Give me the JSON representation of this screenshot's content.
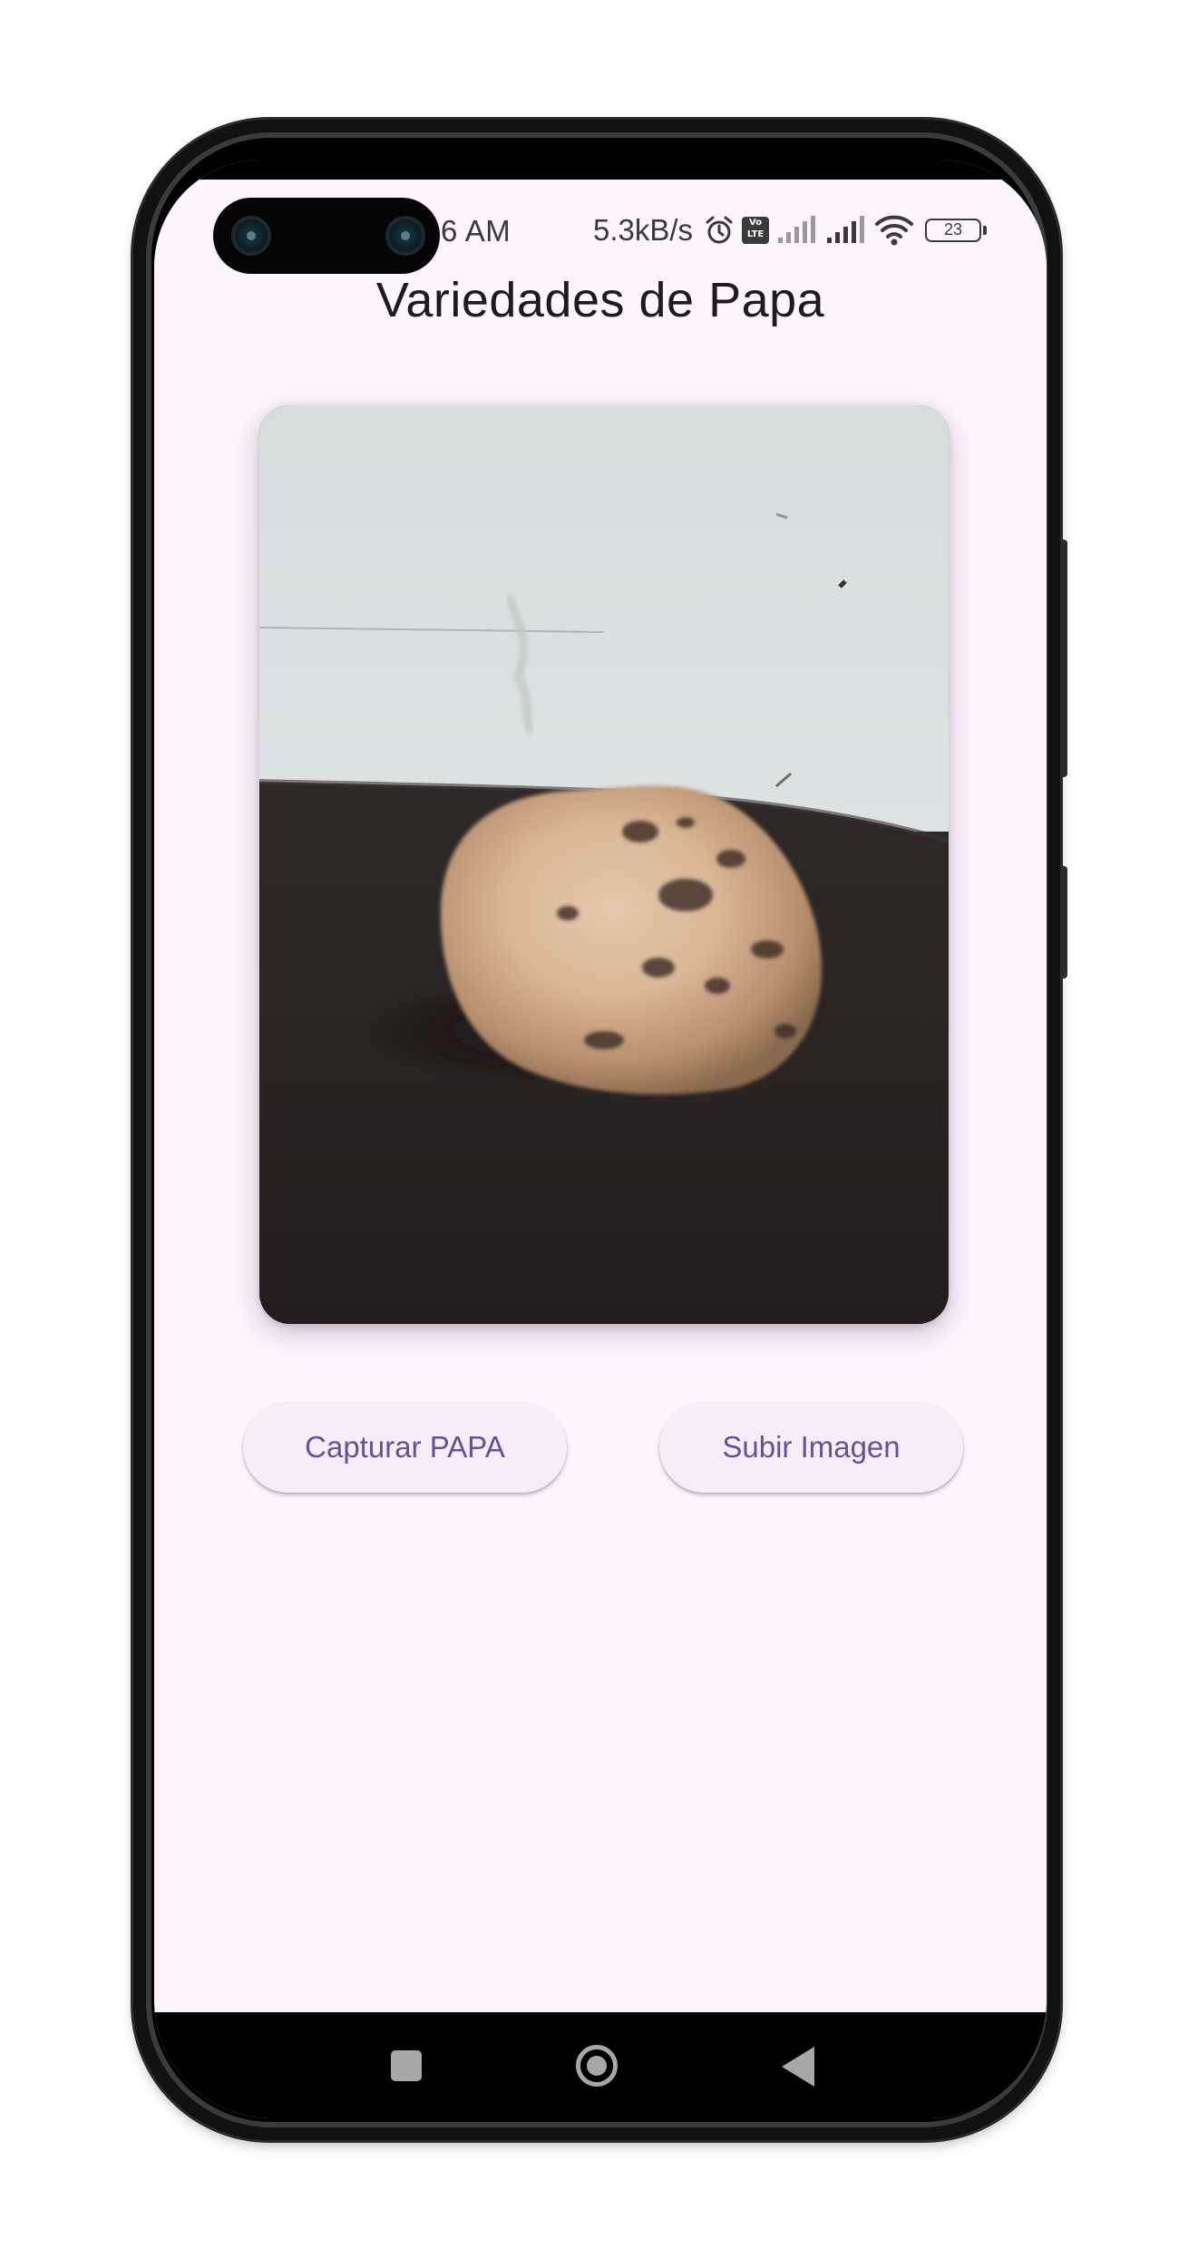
{
  "status_bar": {
    "time": "6 AM",
    "network_speed": "5.3kB/s",
    "volte_label": "Vo LTE",
    "battery_level": "23",
    "icons": [
      "alarm-icon",
      "volte-icon",
      "signal-icon",
      "signal-icon",
      "wifi-icon",
      "battery-icon"
    ]
  },
  "app": {
    "title": "Variedades de Papa",
    "preview_image_description_icon": "photo-of-potato",
    "buttons": {
      "capture_label": "Capturar PAPA",
      "upload_label": "Subir Imagen"
    }
  },
  "navigation": {
    "icons": [
      "recents-icon",
      "home-icon",
      "back-icon"
    ]
  },
  "colors": {
    "screen_background": "#fcf5fc",
    "button_background": "#f5eef6",
    "button_text": "#65519b",
    "title_text": "#1d1b20",
    "nav_background": "#000000",
    "nav_icon": "#a7a7a7"
  }
}
